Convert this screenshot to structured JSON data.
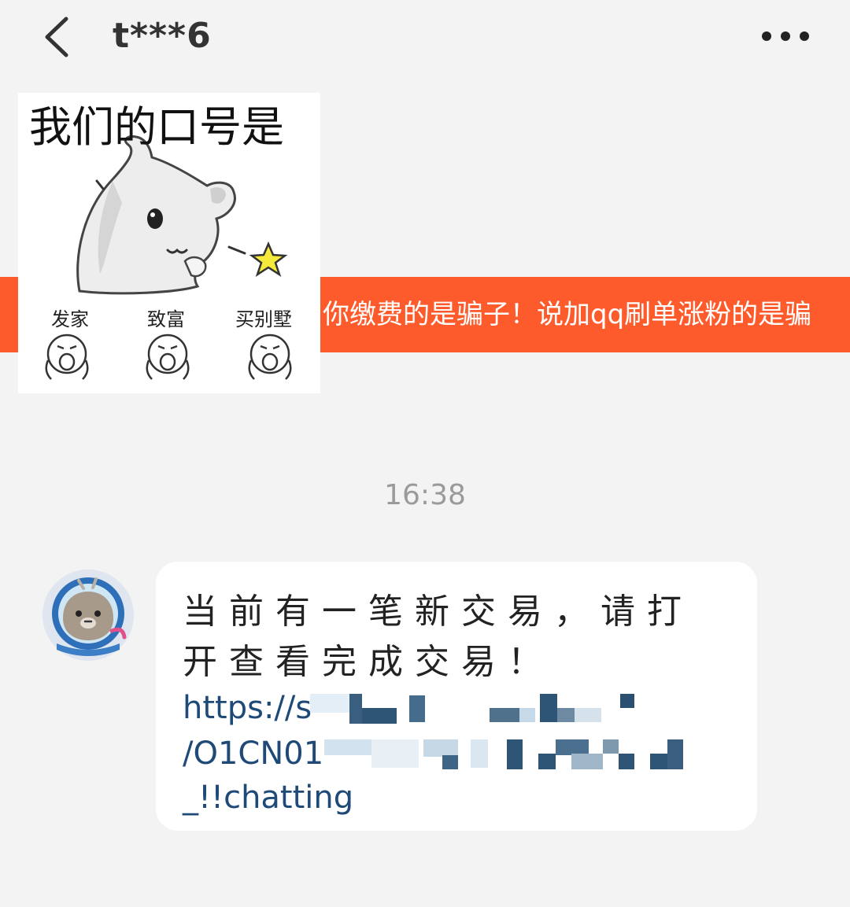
{
  "header": {
    "title": "t***6"
  },
  "sticker": {
    "title": "我们的口号是",
    "words": [
      "发家",
      "致富",
      "买别墅"
    ]
  },
  "banner": {
    "text": "你缴费的是骗子！说加qq刷单涨粉的是骗"
  },
  "timestamp": "16:38",
  "message": {
    "text": "当前有一笔新交易，请打开查看完成交易！",
    "link_line1": "https://s",
    "link_line2": "/O1CN01",
    "link_line3": "_!!chatting"
  },
  "colors": {
    "banner": "#fe5b2c",
    "link": "#1f4a78",
    "background": "#f3f3f3",
    "bubble": "#ffffff"
  }
}
